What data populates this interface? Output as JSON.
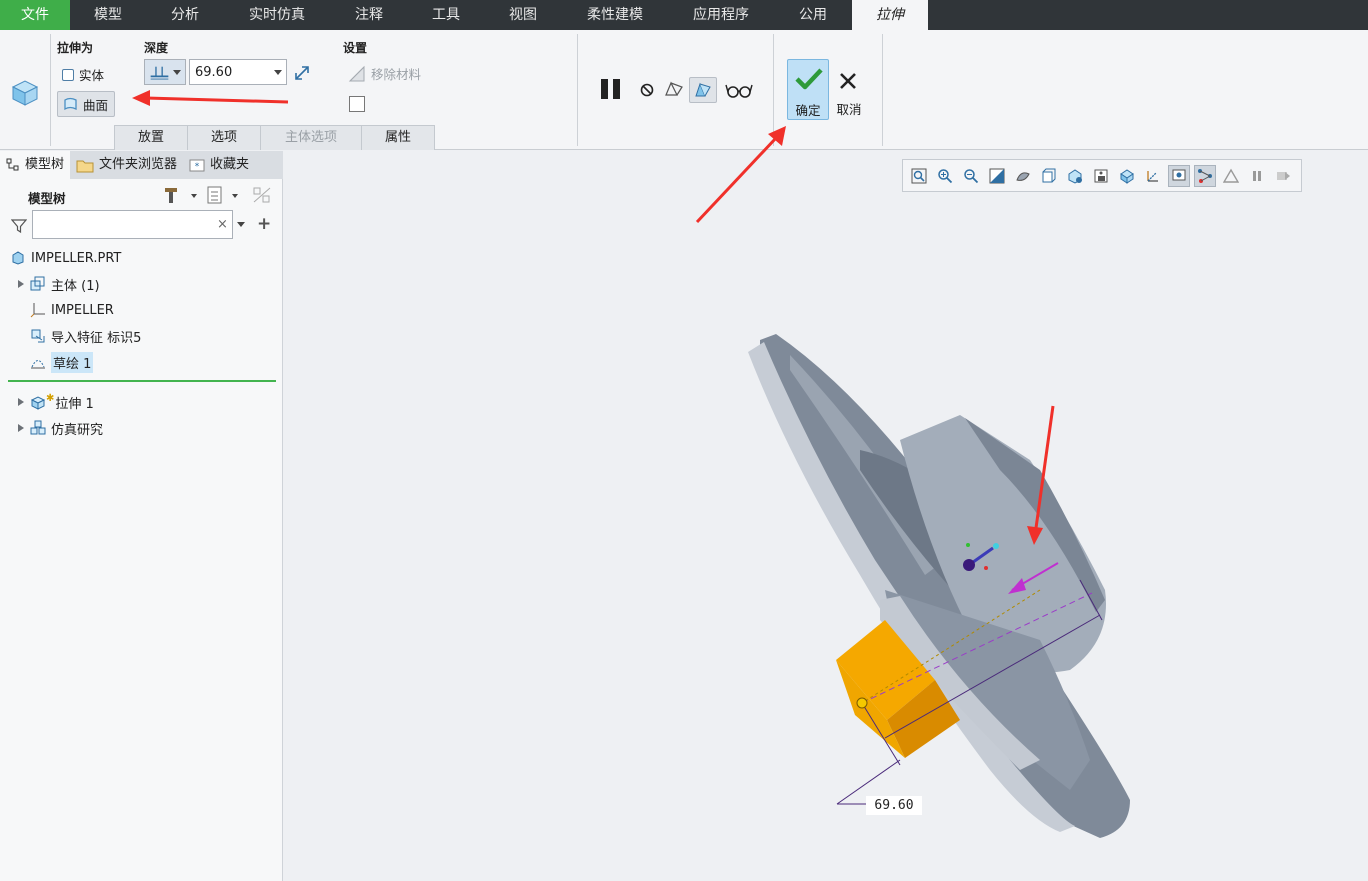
{
  "menubar": {
    "tabs": [
      "文件",
      "模型",
      "分析",
      "实时仿真",
      "注释",
      "工具",
      "视图",
      "柔性建模",
      "应用程序",
      "公用",
      "拉伸"
    ]
  },
  "ribbon": {
    "extrude_as_label": "拉伸为",
    "solid_label": "实体",
    "surface_label": "曲面",
    "depth_label": "深度",
    "depth_value": "69.60",
    "settings_label": "设置",
    "remove_material_label": "移除材料",
    "subtabs": [
      "放置",
      "选项",
      "主体选项",
      "属性"
    ],
    "ok_label": "确定",
    "cancel_label": "取消"
  },
  "panel": {
    "tabs": [
      "模型树",
      "文件夹浏览器",
      "收藏夹"
    ],
    "tree_title": "模型树",
    "filter_placeholder": "",
    "items": [
      "IMPELLER.PRT",
      "主体 (1)",
      "IMPELLER",
      "导入特征 标识5",
      "草绘 1",
      "拉伸 1",
      "仿真研究"
    ]
  },
  "viewport": {
    "dimension_value": "69.60"
  },
  "colors": {
    "file_tab": "#3fae49",
    "menubar": "#303539",
    "ok_button": "#bfe0f6",
    "annotation_arrow": "#f0302a",
    "extrude_preview": "#f5a800",
    "model": "#8e99a8"
  }
}
